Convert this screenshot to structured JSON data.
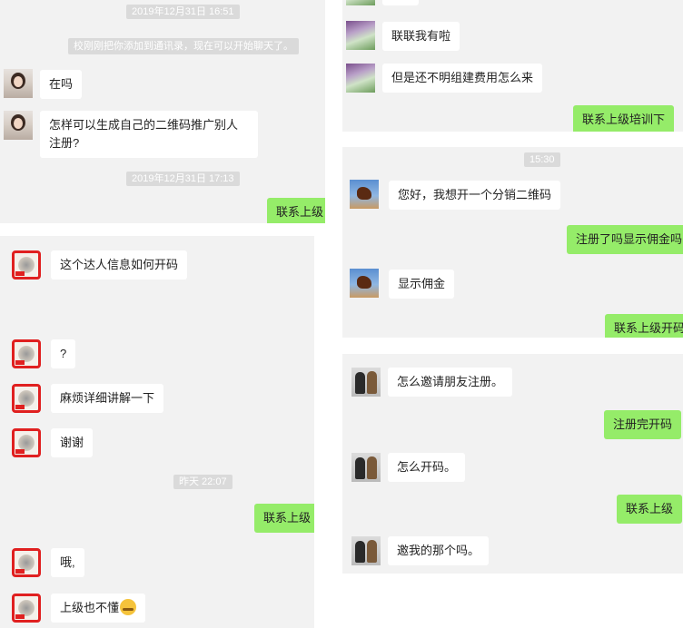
{
  "panel1": {
    "timestamp1": "2019年12月31日 16:51",
    "notice": "校刚刚把你添加到通讯录，现在可以开始聊天了。",
    "messages": [
      {
        "text": "在吗"
      },
      {
        "text": "怎样可以生成自己的二维码推广别人注册?"
      }
    ],
    "timestamp2": "2019年12月31日 17:13",
    "me_message": "联系上级"
  },
  "panel2": {
    "messages": [
      {
        "text": "这个达人信息如何开码"
      },
      {
        "text": "?"
      },
      {
        "text": "麻烦详细讲解一下"
      },
      {
        "text": "谢谢"
      }
    ],
    "timestamp": "昨天 22:07",
    "me_message": "联系上级",
    "messages_after": [
      {
        "text": "哦,"
      },
      {
        "text": "上级也不懂"
      }
    ]
  },
  "panel3": {
    "messages": [
      {
        "text": "联联我有啦"
      },
      {
        "text": "但是还不明组建费用怎么来"
      }
    ],
    "me_message": "联系上级培训下"
  },
  "panel4": {
    "timestamp": "15:30",
    "message1": "您好，我想开一个分销二维码",
    "me_message1": "注册了吗显示佣金吗",
    "message2": "显示佣金",
    "me_message2": "联系上级开码"
  },
  "panel5": {
    "message1": "怎么邀请朋友注册。",
    "me_message1": "注册完开码",
    "message2": "怎么开码。",
    "me_message2": "联系上级",
    "message3": "邀我的那个吗。"
  },
  "icons": {
    "emoji": "sweat-smile-emoji"
  }
}
